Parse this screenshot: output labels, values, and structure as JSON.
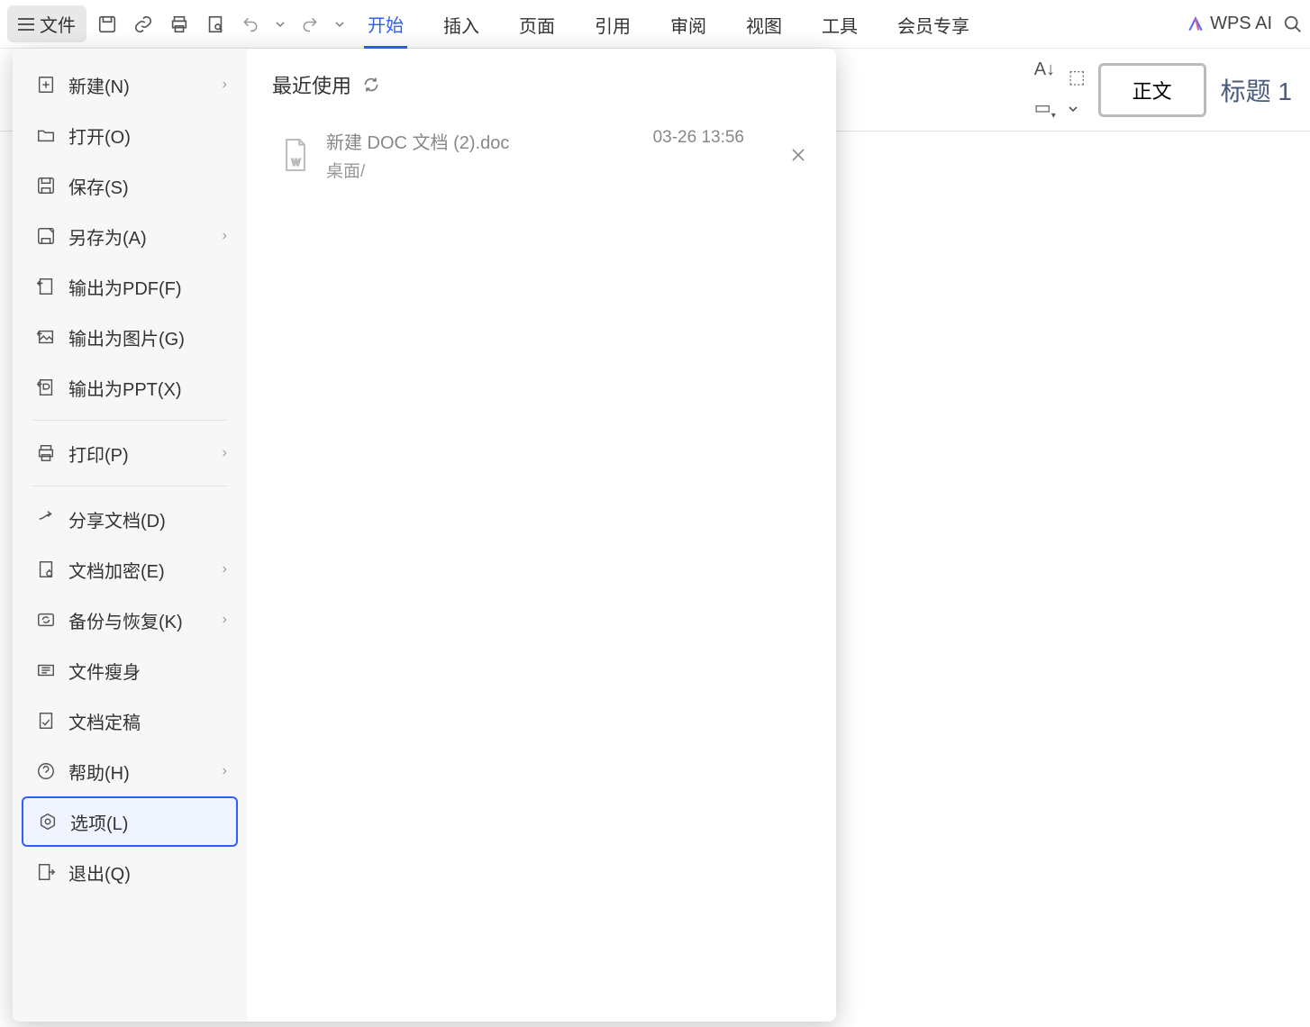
{
  "toolbar": {
    "file_label": "文件",
    "wps_ai_label": "WPS AI"
  },
  "tabs": [
    {
      "label": "开始",
      "active": true
    },
    {
      "label": "插入",
      "active": false
    },
    {
      "label": "页面",
      "active": false
    },
    {
      "label": "引用",
      "active": false
    },
    {
      "label": "审阅",
      "active": false
    },
    {
      "label": "视图",
      "active": false
    },
    {
      "label": "工具",
      "active": false
    },
    {
      "label": "会员专享",
      "active": false
    }
  ],
  "ribbon": {
    "style_body": "正文",
    "style_heading": "标题 1"
  },
  "file_menu": {
    "items": [
      {
        "label": "新建(N)",
        "icon": "new",
        "chevron": true
      },
      {
        "label": "打开(O)",
        "icon": "open",
        "chevron": false
      },
      {
        "label": "保存(S)",
        "icon": "save",
        "chevron": false
      },
      {
        "label": "另存为(A)",
        "icon": "saveas",
        "chevron": true
      },
      {
        "label": "输出为PDF(F)",
        "icon": "pdf",
        "chevron": false
      },
      {
        "label": "输出为图片(G)",
        "icon": "image",
        "chevron": false
      },
      {
        "label": "输出为PPT(X)",
        "icon": "ppt",
        "chevron": false
      },
      {
        "label": "打印(P)",
        "icon": "print",
        "chevron": true,
        "divider_before": true
      },
      {
        "label": "分享文档(D)",
        "icon": "share",
        "chevron": false,
        "divider_before": true
      },
      {
        "label": "文档加密(E)",
        "icon": "encrypt",
        "chevron": true
      },
      {
        "label": "备份与恢复(K)",
        "icon": "backup",
        "chevron": true
      },
      {
        "label": "文件瘦身",
        "icon": "slim",
        "chevron": false
      },
      {
        "label": "文档定稿",
        "icon": "final",
        "chevron": false
      },
      {
        "label": "帮助(H)",
        "icon": "help",
        "chevron": true
      },
      {
        "label": "选项(L)",
        "icon": "options",
        "chevron": false,
        "selected": true
      },
      {
        "label": "退出(Q)",
        "icon": "exit",
        "chevron": false
      }
    ]
  },
  "recent": {
    "title": "最近使用",
    "files": [
      {
        "name": "新建 DOC 文档 (2).doc",
        "path": "桌面/",
        "time": "03-26 13:56"
      }
    ]
  }
}
